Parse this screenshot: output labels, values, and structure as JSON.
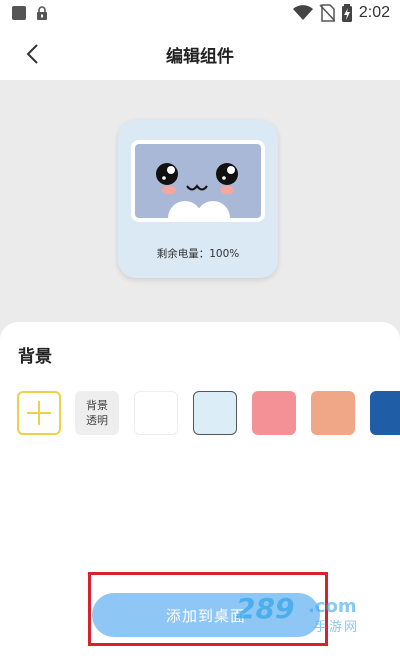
{
  "status_bar": {
    "time": "2:02",
    "icons": [
      "notification-square-icon",
      "lock-icon",
      "wifi-icon",
      "no-sim-icon",
      "battery-charging-icon"
    ]
  },
  "header": {
    "title": "编辑组件",
    "back_icon": "chevron-left-icon"
  },
  "preview": {
    "status_text": "剩余电量：100%",
    "card_color": "#dbe9f4",
    "screen_color": "#a9b8d6"
  },
  "background_section": {
    "title": "背景",
    "transparent_line1": "背景",
    "transparent_line2": "透明",
    "swatches": [
      {
        "name": "add",
        "icon": "plus-icon",
        "color": "#f0cf4a"
      },
      {
        "name": "transparent",
        "color": "#eeeeee"
      },
      {
        "name": "white",
        "color": "#ffffff"
      },
      {
        "name": "light-blue",
        "color": "#dbeef7",
        "selected": true
      },
      {
        "name": "pink",
        "color": "#f39197"
      },
      {
        "name": "peach",
        "color": "#f0a787"
      },
      {
        "name": "blue",
        "color": "#1f5ea7"
      }
    ]
  },
  "footer": {
    "add_button_label": "添加到桌面",
    "button_color": "#8ec6f5",
    "highlight_color": "#d6222c"
  },
  "watermark": {
    "number": "289",
    "domain": ".com",
    "label": "手游网"
  }
}
